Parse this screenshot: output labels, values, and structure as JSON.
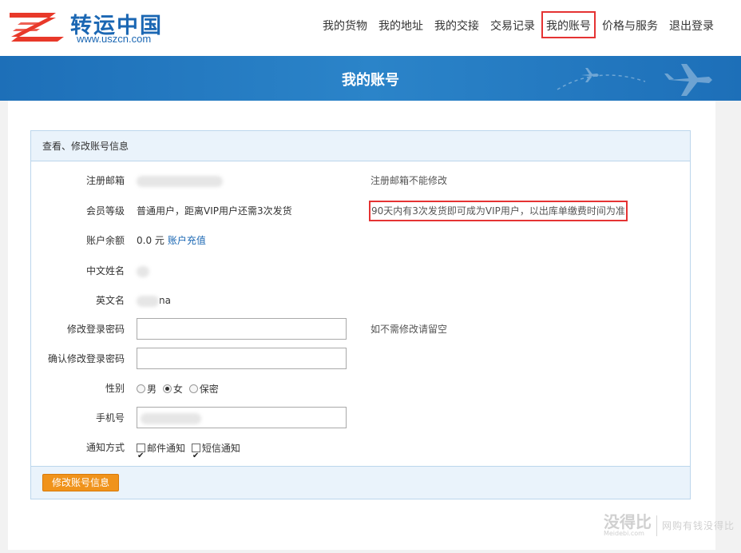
{
  "header": {
    "brand": "转运中国",
    "url": "www.uszcn.com",
    "nav": [
      {
        "label": "我的货物"
      },
      {
        "label": "我的地址"
      },
      {
        "label": "我的交接"
      },
      {
        "label": "交易记录"
      },
      {
        "label": "我的账号"
      },
      {
        "label": "价格与服务"
      },
      {
        "label": "退出登录"
      }
    ],
    "active_nav": "我的账号"
  },
  "banner": {
    "title": "我的账号"
  },
  "panel": {
    "title": "查看、修改账号信息",
    "email": {
      "label": "注册邮箱",
      "note": "注册邮箱不能修改"
    },
    "level": {
      "label": "会员等级",
      "value": "普通用户，距离VIP用户还需3次发货",
      "note": "90天内有3次发货即可成为VIP用户，以出库单缴费时间为准"
    },
    "balance": {
      "label": "账户余额",
      "value": "0.0 元",
      "link": "账户充值"
    },
    "cn_name": {
      "label": "中文姓名",
      "suffix": "3"
    },
    "en_name": {
      "label": "英文名",
      "suffix": "na"
    },
    "password": {
      "label": "修改登录密码",
      "note": "如不需修改请留空"
    },
    "confirm_password": {
      "label": "确认修改登录密码"
    },
    "gender": {
      "label": "性别",
      "options": [
        "男",
        "女",
        "保密"
      ],
      "selected": "女"
    },
    "phone": {
      "label": "手机号"
    },
    "notify": {
      "label": "通知方式",
      "options": [
        "邮件通知",
        "短信通知"
      ]
    },
    "submit": "修改账号信息"
  },
  "watermark": {
    "logo": "没得比",
    "sub": "Meidebi.com",
    "slogan": "网购有钱没得比"
  },
  "colors": {
    "accent": "#1b67b3",
    "highlight": "#e53333",
    "button": "#f0931b"
  }
}
